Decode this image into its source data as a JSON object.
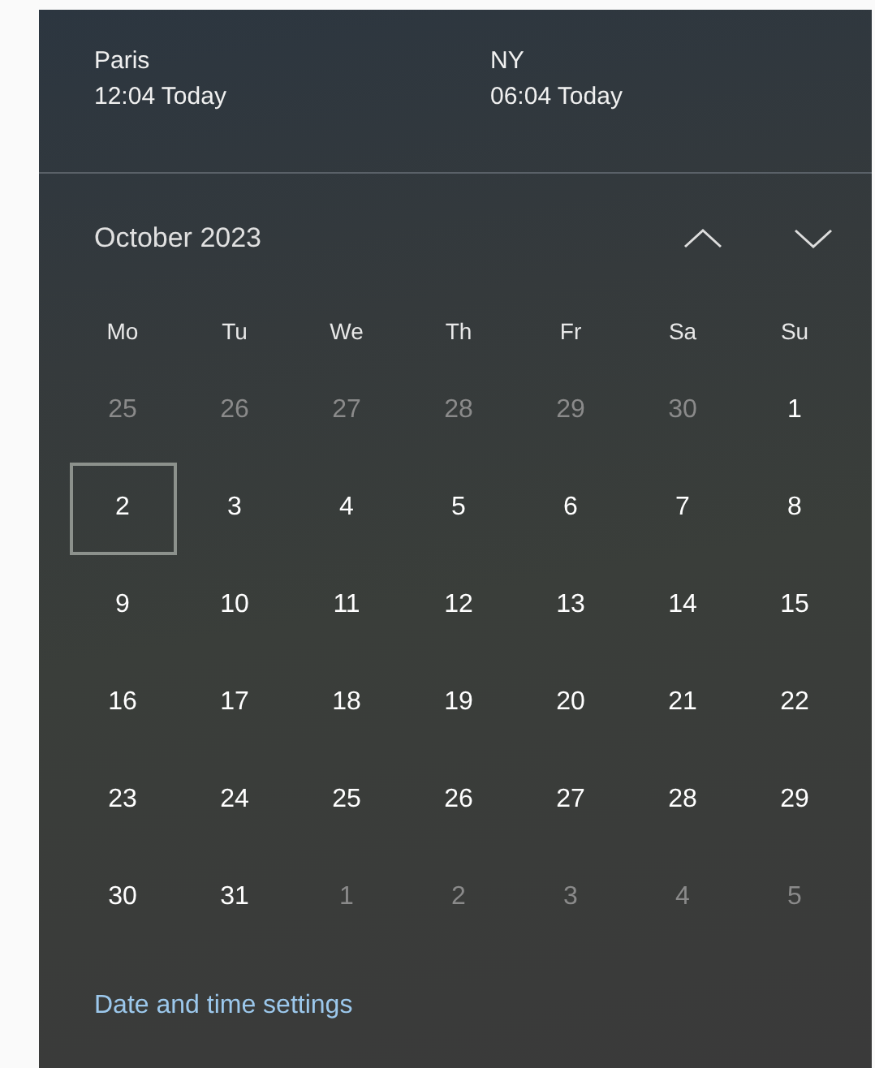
{
  "clocks": [
    {
      "city": "Paris",
      "time": "12:04 Today"
    },
    {
      "city": "NY",
      "time": "06:04 Today"
    }
  ],
  "calendar": {
    "month": "October 2023",
    "weekdays": [
      "Mo",
      "Tu",
      "We",
      "Th",
      "Fr",
      "Sa",
      "Su"
    ],
    "days": [
      {
        "label": "25",
        "in_month": false,
        "today": false
      },
      {
        "label": "26",
        "in_month": false,
        "today": false
      },
      {
        "label": "27",
        "in_month": false,
        "today": false
      },
      {
        "label": "28",
        "in_month": false,
        "today": false
      },
      {
        "label": "29",
        "in_month": false,
        "today": false
      },
      {
        "label": "30",
        "in_month": false,
        "today": false
      },
      {
        "label": "1",
        "in_month": true,
        "today": false
      },
      {
        "label": "2",
        "in_month": true,
        "today": true
      },
      {
        "label": "3",
        "in_month": true,
        "today": false
      },
      {
        "label": "4",
        "in_month": true,
        "today": false
      },
      {
        "label": "5",
        "in_month": true,
        "today": false
      },
      {
        "label": "6",
        "in_month": true,
        "today": false
      },
      {
        "label": "7",
        "in_month": true,
        "today": false
      },
      {
        "label": "8",
        "in_month": true,
        "today": false
      },
      {
        "label": "9",
        "in_month": true,
        "today": false
      },
      {
        "label": "10",
        "in_month": true,
        "today": false
      },
      {
        "label": "11",
        "in_month": true,
        "today": false
      },
      {
        "label": "12",
        "in_month": true,
        "today": false
      },
      {
        "label": "13",
        "in_month": true,
        "today": false
      },
      {
        "label": "14",
        "in_month": true,
        "today": false
      },
      {
        "label": "15",
        "in_month": true,
        "today": false
      },
      {
        "label": "16",
        "in_month": true,
        "today": false
      },
      {
        "label": "17",
        "in_month": true,
        "today": false
      },
      {
        "label": "18",
        "in_month": true,
        "today": false
      },
      {
        "label": "19",
        "in_month": true,
        "today": false
      },
      {
        "label": "20",
        "in_month": true,
        "today": false
      },
      {
        "label": "21",
        "in_month": true,
        "today": false
      },
      {
        "label": "22",
        "in_month": true,
        "today": false
      },
      {
        "label": "23",
        "in_month": true,
        "today": false
      },
      {
        "label": "24",
        "in_month": true,
        "today": false
      },
      {
        "label": "25",
        "in_month": true,
        "today": false
      },
      {
        "label": "26",
        "in_month": true,
        "today": false
      },
      {
        "label": "27",
        "in_month": true,
        "today": false
      },
      {
        "label": "28",
        "in_month": true,
        "today": false
      },
      {
        "label": "29",
        "in_month": true,
        "today": false
      },
      {
        "label": "30",
        "in_month": true,
        "today": false
      },
      {
        "label": "31",
        "in_month": true,
        "today": false
      },
      {
        "label": "1",
        "in_month": false,
        "today": false
      },
      {
        "label": "2",
        "in_month": false,
        "today": false
      },
      {
        "label": "3",
        "in_month": false,
        "today": false
      },
      {
        "label": "4",
        "in_month": false,
        "today": false
      },
      {
        "label": "5",
        "in_month": false,
        "today": false
      }
    ]
  },
  "settings_link": "Date and time settings"
}
